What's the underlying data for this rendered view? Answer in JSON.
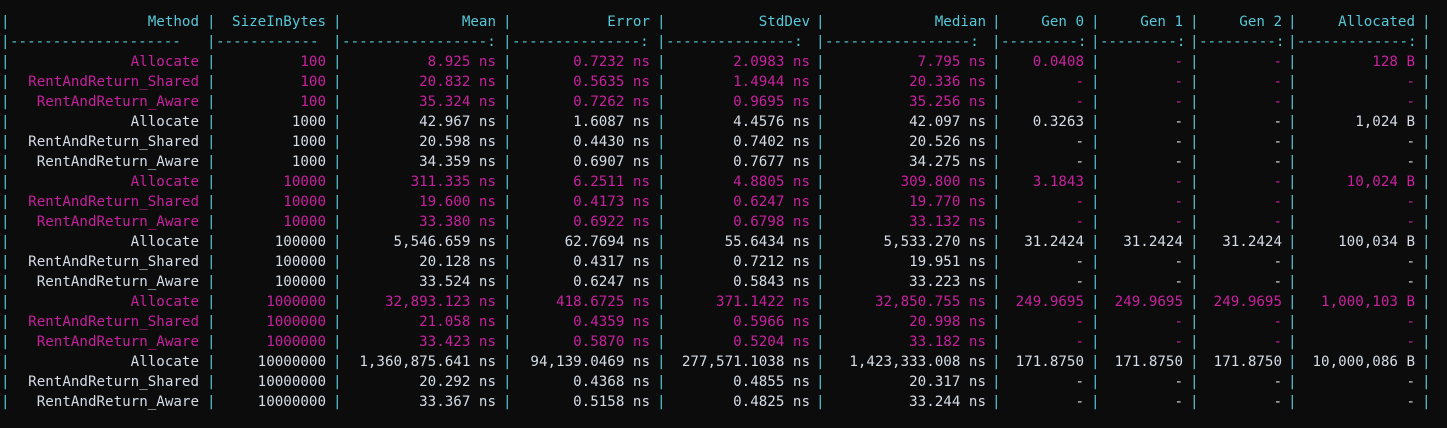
{
  "theme": {
    "background": "#0c0c0c",
    "pipe_color": "#56c8d8",
    "normal_text_color": "#d4dce6",
    "highlight_text_color": "#c8209e"
  },
  "table": {
    "headers": [
      "Method",
      "SizeInBytes",
      "Mean",
      "Error",
      "StdDev",
      "Median",
      "Gen 0",
      "Gen 1",
      "Gen 2",
      "Allocated"
    ],
    "separator": [
      "--------------------",
      "------------",
      "-----------------:",
      "---------------:",
      "---------------:",
      "-----------------:",
      "---------:",
      "---------:",
      "---------:",
      "-------------:"
    ],
    "rows": [
      {
        "highlight": true,
        "cells": [
          "Allocate",
          "100",
          "8.925 ns",
          "0.7232 ns",
          "2.0983 ns",
          "7.795 ns",
          "0.0408",
          "-",
          "-",
          "128 B"
        ]
      },
      {
        "highlight": true,
        "cells": [
          "RentAndReturn_Shared",
          "100",
          "20.832 ns",
          "0.5635 ns",
          "1.4944 ns",
          "20.336 ns",
          "-",
          "-",
          "-",
          "-"
        ]
      },
      {
        "highlight": true,
        "cells": [
          "RentAndReturn_Aware",
          "100",
          "35.324 ns",
          "0.7262 ns",
          "0.9695 ns",
          "35.256 ns",
          "-",
          "-",
          "-",
          "-"
        ]
      },
      {
        "highlight": false,
        "cells": [
          "Allocate",
          "1000",
          "42.967 ns",
          "1.6087 ns",
          "4.4576 ns",
          "42.097 ns",
          "0.3263",
          "-",
          "-",
          "1,024 B"
        ]
      },
      {
        "highlight": false,
        "cells": [
          "RentAndReturn_Shared",
          "1000",
          "20.598 ns",
          "0.4430 ns",
          "0.7402 ns",
          "20.526 ns",
          "-",
          "-",
          "-",
          "-"
        ]
      },
      {
        "highlight": false,
        "cells": [
          "RentAndReturn_Aware",
          "1000",
          "34.359 ns",
          "0.6907 ns",
          "0.7677 ns",
          "34.275 ns",
          "-",
          "-",
          "-",
          "-"
        ]
      },
      {
        "highlight": true,
        "cells": [
          "Allocate",
          "10000",
          "311.335 ns",
          "6.2511 ns",
          "4.8805 ns",
          "309.800 ns",
          "3.1843",
          "-",
          "-",
          "10,024 B"
        ]
      },
      {
        "highlight": true,
        "cells": [
          "RentAndReturn_Shared",
          "10000",
          "19.600 ns",
          "0.4173 ns",
          "0.6247 ns",
          "19.770 ns",
          "-",
          "-",
          "-",
          "-"
        ]
      },
      {
        "highlight": true,
        "cells": [
          "RentAndReturn_Aware",
          "10000",
          "33.380 ns",
          "0.6922 ns",
          "0.6798 ns",
          "33.132 ns",
          "-",
          "-",
          "-",
          "-"
        ]
      },
      {
        "highlight": false,
        "cells": [
          "Allocate",
          "100000",
          "5,546.659 ns",
          "62.7694 ns",
          "55.6434 ns",
          "5,533.270 ns",
          "31.2424",
          "31.2424",
          "31.2424",
          "100,034 B"
        ]
      },
      {
        "highlight": false,
        "cells": [
          "RentAndReturn_Shared",
          "100000",
          "20.128 ns",
          "0.4317 ns",
          "0.7212 ns",
          "19.951 ns",
          "-",
          "-",
          "-",
          "-"
        ]
      },
      {
        "highlight": false,
        "cells": [
          "RentAndReturn_Aware",
          "100000",
          "33.524 ns",
          "0.6247 ns",
          "0.5843 ns",
          "33.223 ns",
          "-",
          "-",
          "-",
          "-"
        ]
      },
      {
        "highlight": true,
        "cells": [
          "Allocate",
          "1000000",
          "32,893.123 ns",
          "418.6725 ns",
          "371.1422 ns",
          "32,850.755 ns",
          "249.9695",
          "249.9695",
          "249.9695",
          "1,000,103 B"
        ]
      },
      {
        "highlight": true,
        "cells": [
          "RentAndReturn_Shared",
          "1000000",
          "21.058 ns",
          "0.4359 ns",
          "0.5966 ns",
          "20.998 ns",
          "-",
          "-",
          "-",
          "-"
        ]
      },
      {
        "highlight": true,
        "cells": [
          "RentAndReturn_Aware",
          "1000000",
          "33.423 ns",
          "0.5870 ns",
          "0.5204 ns",
          "33.182 ns",
          "-",
          "-",
          "-",
          "-"
        ]
      },
      {
        "highlight": false,
        "cells": [
          "Allocate",
          "10000000",
          "1,360,875.641 ns",
          "94,139.0469 ns",
          "277,571.1038 ns",
          "1,423,333.008 ns",
          "171.8750",
          "171.8750",
          "171.8750",
          "10,000,086 B"
        ]
      },
      {
        "highlight": false,
        "cells": [
          "RentAndReturn_Shared",
          "10000000",
          "20.292 ns",
          "0.4368 ns",
          "0.4855 ns",
          "20.317 ns",
          "-",
          "-",
          "-",
          "-"
        ]
      },
      {
        "highlight": false,
        "cells": [
          "RentAndReturn_Aware",
          "10000000",
          "33.367 ns",
          "0.5158 ns",
          "0.4825 ns",
          "33.244 ns",
          "-",
          "-",
          "-",
          "-"
        ]
      }
    ]
  }
}
